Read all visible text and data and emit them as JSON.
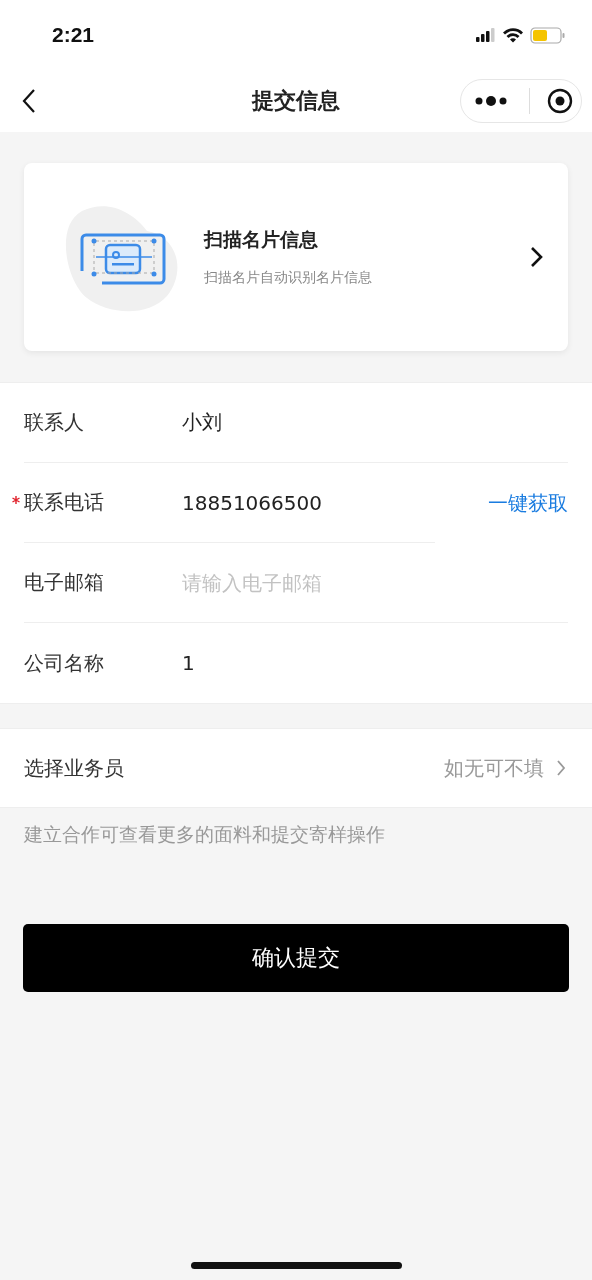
{
  "status_bar": {
    "time": "2:21"
  },
  "nav": {
    "title": "提交信息"
  },
  "scan_card": {
    "title": "扫描名片信息",
    "subtitle": "扫描名片自动识别名片信息"
  },
  "fields": [
    {
      "label": "联系人",
      "value": "小刘",
      "required": false
    },
    {
      "label": "联系电话",
      "value": "18851066500",
      "required": true,
      "action": "一键获取"
    },
    {
      "label": "电子邮箱",
      "placeholder": "请输入电子邮箱",
      "required": false
    },
    {
      "label": "公司名称",
      "value": "1",
      "required": false
    }
  ],
  "salesperson": {
    "label": "选择业务员",
    "hint": "如无可不填"
  },
  "note": "建立合作可查看更多的面料和提交寄样操作",
  "submit_button": "确认提交"
}
